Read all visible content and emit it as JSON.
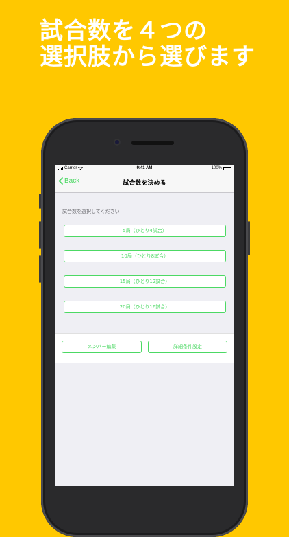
{
  "promo": {
    "line1": "試合数を４つの",
    "line2": "選択肢から選びます"
  },
  "status_bar": {
    "carrier": "Carrier",
    "time": "9:41 AM",
    "battery": "100%",
    "battery_level": 1.0
  },
  "nav": {
    "back_label": "Back",
    "title": "試合数を決める"
  },
  "section_label": "試合数を選択してください",
  "options": [
    "5局（ひとり4試合）",
    "10局（ひとり8試合）",
    "15局（ひとり12試合）",
    "20局（ひとり16試合）"
  ],
  "bottom": {
    "member_edit": "メンバー編集",
    "detail_settings": "詳細条件設定"
  },
  "colors": {
    "background": "#FFC800",
    "accent": "#4CD964",
    "phone_body": "#2A2A2C"
  },
  "icons": [
    "wifi-icon",
    "signal-icon",
    "battery-icon",
    "chevron-left-icon"
  ]
}
